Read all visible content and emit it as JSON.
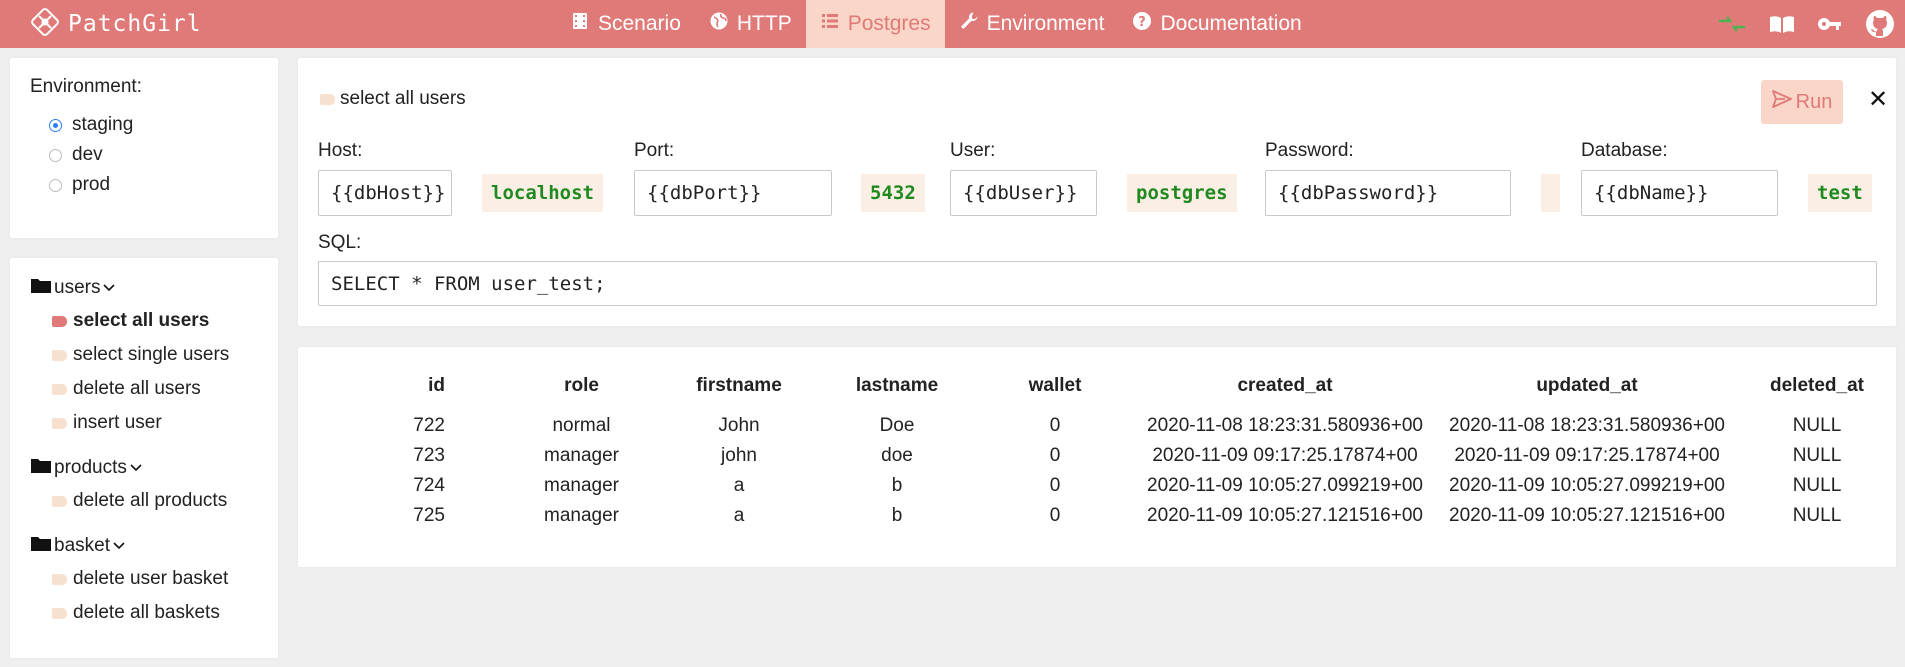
{
  "app": {
    "name": "PatchGirl"
  },
  "nav": {
    "items": [
      {
        "label": "Scenario",
        "icon": "film-icon"
      },
      {
        "label": "HTTP",
        "icon": "globe-icon"
      },
      {
        "label": "Postgres",
        "icon": "list-icon",
        "active": true
      },
      {
        "label": "Environment",
        "icon": "wrench-icon"
      },
      {
        "label": "Documentation",
        "icon": "question-icon"
      }
    ],
    "right_icons": [
      "swap-arrows-icon",
      "book-icon",
      "key-icon",
      "github-icon"
    ]
  },
  "environment": {
    "title": "Environment:",
    "options": [
      {
        "label": "staging",
        "selected": true
      },
      {
        "label": "dev",
        "selected": false
      },
      {
        "label": "prod",
        "selected": false
      }
    ]
  },
  "tree": {
    "folders": [
      {
        "name": "users",
        "items": [
          "select all users",
          "select single users",
          "delete all users",
          "insert user"
        ]
      },
      {
        "name": "products",
        "items": [
          "delete all products"
        ]
      },
      {
        "name": "basket",
        "items": [
          "delete user basket",
          "delete all baskets"
        ]
      }
    ],
    "active_item": "select all users"
  },
  "request": {
    "name": "select all users",
    "run_label": "Run",
    "fields": {
      "host": {
        "label": "Host:",
        "template": "{{dbHost}}",
        "value": "localhost"
      },
      "port": {
        "label": "Port:",
        "template": "{{dbPort}}",
        "value": "5432"
      },
      "user": {
        "label": "User:",
        "template": "{{dbUser}}",
        "value": "postgres"
      },
      "password": {
        "label": "Password:",
        "template": "{{dbPassword}}",
        "value": ""
      },
      "database": {
        "label": "Database:",
        "template": "{{dbName}}",
        "value": "test"
      }
    },
    "sql": {
      "label": "SQL:",
      "value": "SELECT * FROM user_test;"
    }
  },
  "results": {
    "columns": [
      "id",
      "role",
      "firstname",
      "lastname",
      "wallet",
      "created_at",
      "updated_at",
      "deleted_at"
    ],
    "rows": [
      [
        "722",
        "normal",
        "John",
        "Doe",
        "0",
        "2020-11-08 18:23:31.580936+00",
        "2020-11-08 18:23:31.580936+00",
        "NULL"
      ],
      [
        "723",
        "manager",
        "john",
        "doe",
        "0",
        "2020-11-09 09:17:25.17874+00",
        "2020-11-09 09:17:25.17874+00",
        "NULL"
      ],
      [
        "724",
        "manager",
        "a",
        "b",
        "0",
        "2020-11-09 10:05:27.099219+00",
        "2020-11-09 10:05:27.099219+00",
        "NULL"
      ],
      [
        "725",
        "manager",
        "a",
        "b",
        "0",
        "2020-11-09 10:05:27.121516+00",
        "2020-11-09 10:05:27.121516+00",
        "NULL"
      ]
    ]
  },
  "colors": {
    "brand": "#e07a78",
    "active_tab_bg": "#f9d6c8",
    "value_green": "#1f8a1f"
  }
}
